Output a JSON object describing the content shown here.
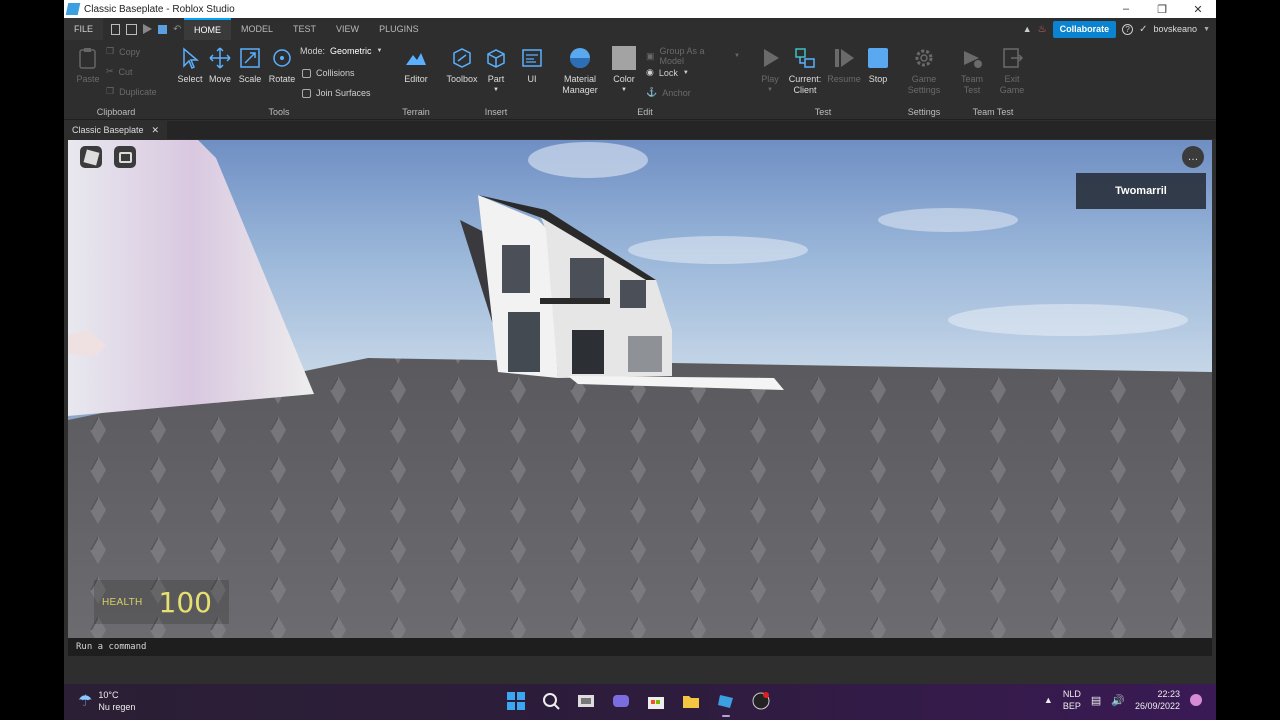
{
  "window": {
    "title": "Classic Baseplate - Roblox Studio"
  },
  "menu": {
    "file": "FILE",
    "tabs": [
      "HOME",
      "MODEL",
      "TEST",
      "VIEW",
      "PLUGINS"
    ],
    "active_tab": "HOME",
    "collaborate": "Collaborate",
    "username": "bovskeano"
  },
  "ribbon": {
    "clipboard": {
      "title": "Clipboard",
      "paste": "Paste",
      "copy": "Copy",
      "cut": "Cut",
      "duplicate": "Duplicate"
    },
    "tools": {
      "title": "Tools",
      "select": "Select",
      "move": "Move",
      "scale": "Scale",
      "rotate": "Rotate",
      "mode_label": "Mode:",
      "mode_value": "Geometric",
      "collisions": "Collisions",
      "join_surfaces": "Join Surfaces"
    },
    "terrain": {
      "title": "Terrain",
      "editor": "Editor"
    },
    "insert": {
      "title": "Insert",
      "toolbox": "Toolbox",
      "part": "Part",
      "ui": "UI"
    },
    "edit": {
      "title": "Edit",
      "material_manager_1": "Material",
      "material_manager_2": "Manager",
      "color": "Color",
      "group_as_model": "Group As a Model",
      "lock": "Lock",
      "anchor": "Anchor"
    },
    "test": {
      "title": "Test",
      "play": "Play",
      "current_client_1": "Current:",
      "current_client_2": "Client",
      "resume": "Resume",
      "stop": "Stop"
    },
    "settings": {
      "title": "Settings",
      "game_settings_1": "Game",
      "game_settings_2": "Settings"
    },
    "team_test": {
      "title": "Team Test",
      "team_test_1": "Team",
      "team_test_2": "Test",
      "exit_game_1": "Exit",
      "exit_game_2": "Game"
    }
  },
  "document": {
    "tab": "Classic Baseplate"
  },
  "game": {
    "player_name": "Twomarril",
    "health_label": "HEALTH",
    "health_value": "100"
  },
  "command_bar": {
    "placeholder": "Run a command"
  },
  "taskbar": {
    "temperature": "10°C",
    "weather": "Nu regen",
    "lang_1": "NLD",
    "lang_2": "BEP",
    "time": "22:23",
    "date": "26/09/2022"
  },
  "colors": {
    "accent": "#00a2ff",
    "collaborate": "#0a84d0",
    "health": "#e6e070"
  }
}
